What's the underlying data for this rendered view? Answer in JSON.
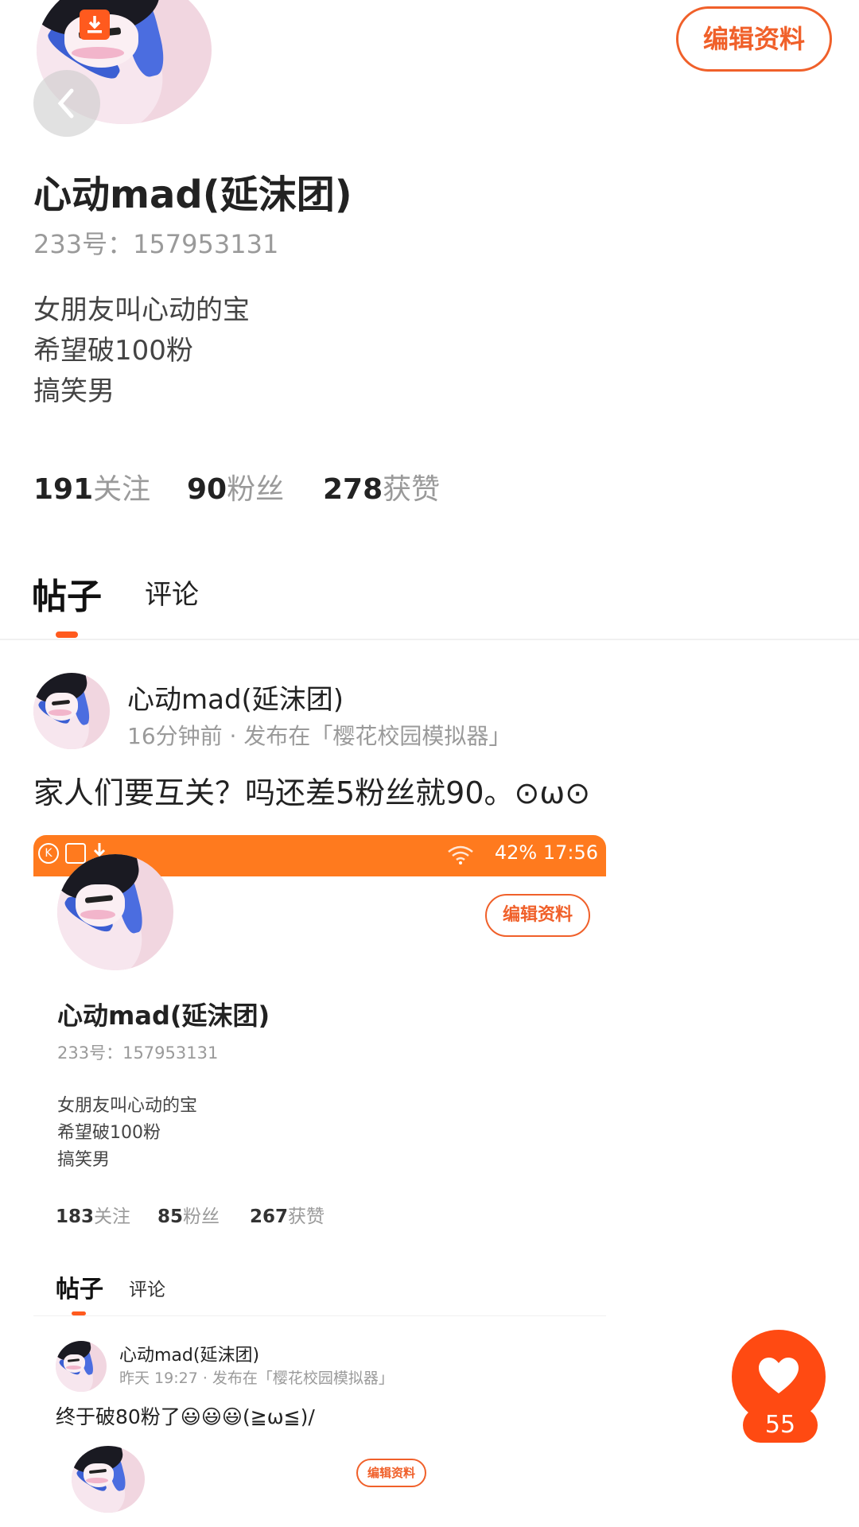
{
  "header": {
    "edit_profile_label": "编辑资料"
  },
  "profile": {
    "name": "心动mad(延沫团)",
    "id_line": "233号：157953131",
    "bio": [
      "女朋友叫心动的宝",
      "希望破100粉",
      "搞笑男"
    ],
    "stats": [
      {
        "number": "191",
        "label": "关注"
      },
      {
        "number": "90",
        "label": "粉丝"
      },
      {
        "number": "278",
        "label": "获赞"
      }
    ]
  },
  "tabs": [
    {
      "label": "帖子",
      "active": true
    },
    {
      "label": "评论",
      "active": false
    }
  ],
  "post": {
    "author": "心动mad(延沫团)",
    "meta": "16分钟前 · 发布在「樱花校园模拟器」",
    "text": "家人们要互关？吗还差5粉丝就90。⊙ω⊙",
    "screenshot": {
      "status_bar": {
        "right": "42% 17:56"
      },
      "edit_profile_label": "编辑资料",
      "name": "心动mad(延沫团)",
      "id_line": "233号：157953131",
      "bio": [
        "女朋友叫心动的宝",
        "希望破100粉",
        "搞笑男"
      ],
      "stats": [
        {
          "number": "183",
          "label": "关注"
        },
        {
          "number": "85",
          "label": "粉丝"
        },
        {
          "number": "267",
          "label": "获赞"
        }
      ],
      "tabs": [
        {
          "label": "帖子"
        },
        {
          "label": "评论"
        }
      ],
      "post": {
        "author": "心动mad(延沫团)",
        "meta": "昨天 19:27 · 发布在「樱花校园模拟器」",
        "text": "终于破80粉了😃😃😃(≧ω≦)/",
        "edit_profile_label": "编辑资料"
      }
    }
  },
  "like": {
    "count": "55"
  },
  "colors": {
    "accent": "#ff5a1e",
    "status_bar": "#ff7a1e",
    "text_muted": "#9a9a9a"
  },
  "icons": [
    "download-icon",
    "back-arrow-icon",
    "heart-icon",
    "wifi-icon",
    "battery-icon"
  ]
}
